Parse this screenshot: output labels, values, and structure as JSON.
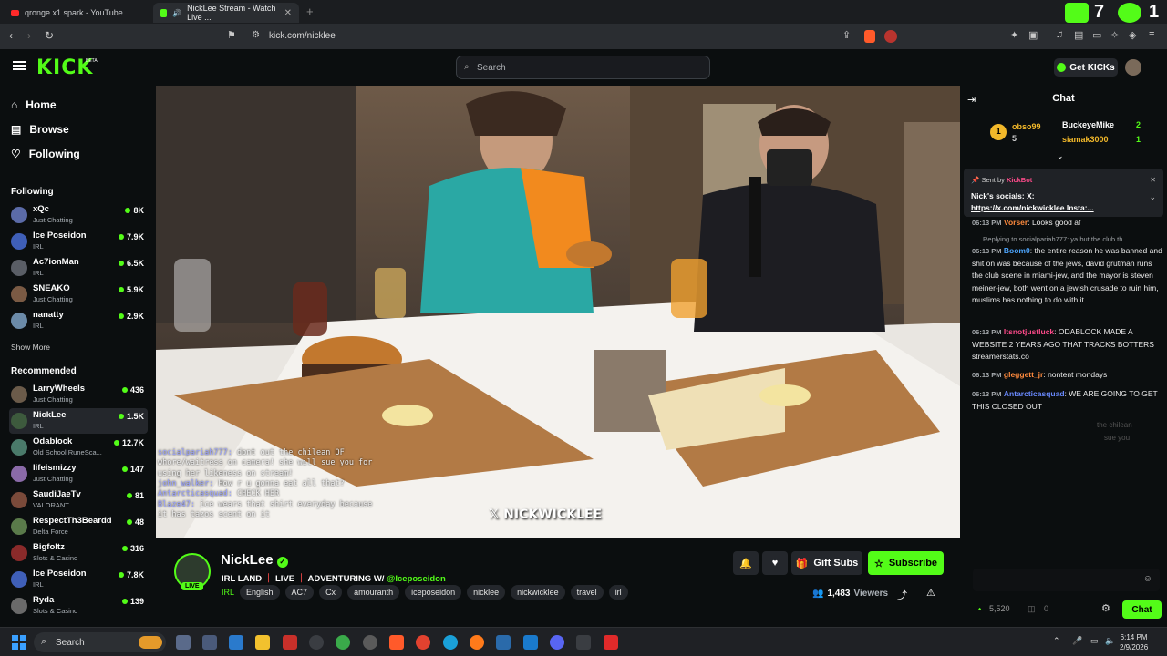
{
  "browser": {
    "tabs": [
      {
        "title": "qronge x1 spark - YouTube",
        "active": false
      },
      {
        "title": "NickLee Stream - Watch Live ...",
        "active": true
      }
    ],
    "url": "kick.com/nicklee",
    "ext_counter_1": "7",
    "ext_counter_2": "1"
  },
  "header": {
    "logo": "KICK",
    "beta": "BETA",
    "search_placeholder": "Search",
    "get_kicks": "Get KICKs"
  },
  "sidebar": {
    "nav": [
      {
        "label": "Home",
        "icon": "home-icon"
      },
      {
        "label": "Browse",
        "icon": "browse-icon"
      },
      {
        "label": "Following",
        "icon": "heart-icon"
      }
    ],
    "following_header": "Following",
    "following": [
      {
        "name": "xQc",
        "category": "Just Chatting",
        "viewers": "8K",
        "color": "#5b6ba8"
      },
      {
        "name": "Ice Poseidon",
        "category": "IRL",
        "viewers": "7.9K",
        "color": "#3f5fb8"
      },
      {
        "name": "Ac7ionMan",
        "category": "IRL",
        "viewers": "6.5K",
        "color": "#5a5e66"
      },
      {
        "name": "SNEAKO",
        "category": "Just Chatting",
        "viewers": "5.9K",
        "color": "#7a5a44"
      },
      {
        "name": "nanatty",
        "category": "IRL",
        "viewers": "2.9K",
        "color": "#6b8aa8"
      }
    ],
    "show_more": "Show More",
    "recommended_header": "Recommended",
    "recommended": [
      {
        "name": "LarryWheels",
        "category": "Just Chatting",
        "viewers": "436",
        "color": "#6b5b4a"
      },
      {
        "name": "NickLee",
        "category": "IRL",
        "viewers": "1.5K",
        "color": "#3d5a3d"
      },
      {
        "name": "Odablock",
        "category": "Old School RuneSca...",
        "viewers": "12.7K",
        "color": "#4a7a6a"
      },
      {
        "name": "lifeismizzy",
        "category": "Just Chatting",
        "viewers": "147",
        "color": "#8a6aa8"
      },
      {
        "name": "SaudiJaeTv",
        "category": "VALORANT",
        "viewers": "81",
        "color": "#7a4a3a"
      },
      {
        "name": "RespectTh3Beardd",
        "category": "Delta Force",
        "viewers": "48",
        "color": "#5a7a4a"
      },
      {
        "name": "Bigfoltz",
        "category": "Slots & Casino",
        "viewers": "316",
        "color": "#8a2a2a"
      },
      {
        "name": "Ice Poseidon",
        "category": "IRL",
        "viewers": "7.8K",
        "color": "#3f5fb8"
      },
      {
        "name": "Ryda",
        "category": "Slots & Casino",
        "viewers": "139",
        "color": "#6a6a6a"
      }
    ]
  },
  "video": {
    "overlay_chat": [
      {
        "user": "socialpariah777:",
        "text": " dont out the chilean OF"
      },
      {
        "user": "",
        "text": "whore/waitress on camera! she will sue you for"
      },
      {
        "user": "",
        "text": "using her likeness on stream!"
      },
      {
        "user": "john_walker:",
        "text": " How r u gonna eat all that?"
      },
      {
        "user": "Antarcticasquad:",
        "text": " CHECK HER"
      },
      {
        "user": "Blaze47:",
        "text": " ice wears that shirt everyday because"
      },
      {
        "user": "",
        "text": "it has tazos scent on it"
      }
    ],
    "watermark": "NICKWICKLEE"
  },
  "stream": {
    "name": "NickLee",
    "live": "LIVE",
    "subtitle_a": "IRL LAND",
    "subtitle_b": "LIVE",
    "subtitle_c": "ADVENTURING W/",
    "subtitle_mention": "@Iceposeidon",
    "category": "IRL",
    "tags": [
      "English",
      "AC7",
      "Cx",
      "amouranth",
      "iceposeidon",
      "nicklee",
      "nickwicklee",
      "travel",
      "irl"
    ],
    "gift_subs": "Gift Subs",
    "subscribe": "Subscribe",
    "viewers": "1,483",
    "viewers_label": "Viewers"
  },
  "chat": {
    "title": "Chat",
    "leaderboard": [
      {
        "rank": "1",
        "name": "obso99",
        "count": "5"
      },
      {
        "name": "BuckeyeMike",
        "count": "2"
      },
      {
        "name": "siamak3000",
        "count": "1"
      }
    ],
    "pinned": {
      "sent_by": "Sent by",
      "sender": "KickBot",
      "line1": "Nick's socials: X:",
      "line2": "https://x.com/nickwicklee Insta:..."
    },
    "messages": [
      {
        "time": "06:13 PM",
        "user": "Vorser",
        "color": "#ff8a3d",
        "text": ": Looks good af"
      },
      {
        "time": "06:13 PM",
        "user": "Boom0",
        "color": "#4da6ff",
        "text": ": the entire reason he was banned and shit on was because of the jews, david grutman runs the club scene in miami-jew, and the mayor is steven meiner-jew, both went on a jewish crusade to ruin him, muslims has nothing to do with it"
      },
      {
        "time": "06:13 PM",
        "user": "Itsnotjustluck",
        "color": "#ff4b8b",
        "text": ": ODABLOCK MADE A WEBSITE 2 YEARS AGO THAT TRACKS BOTTERS streamerstats.co"
      },
      {
        "time": "06:13 PM",
        "user": "gleggett_jr",
        "color": "#ff8a3d",
        "text": ": nontent mondays"
      },
      {
        "time": "06:13 PM",
        "user": "Antarcticasquad",
        "color": "#6a8aff",
        "text": ": WE ARE GOING TO GET THIS CLOSED OUT"
      }
    ],
    "reply_text": "Replying to socialpariah777: ya but the club th...",
    "fade_text": "the chilean",
    "fade_text2": "sue you",
    "points": "5,520",
    "points2": "0",
    "chat_button": "Chat"
  },
  "taskbar": {
    "search": "Search",
    "time": "6:14 PM",
    "date": "2/9/2026"
  }
}
